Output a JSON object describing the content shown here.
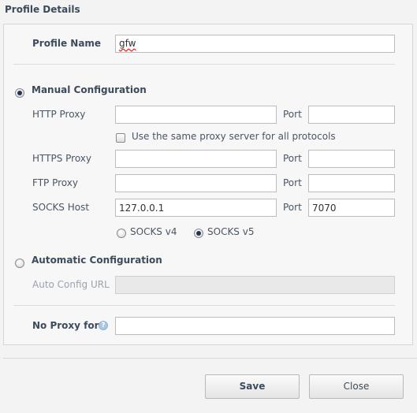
{
  "header": {
    "title": "Profile Details"
  },
  "profile": {
    "name_label": "Profile Name",
    "name_value": "gfw"
  },
  "manual": {
    "label": "Manual Configuration",
    "selected": true,
    "http_label": "HTTP Proxy",
    "http_value": "",
    "http_port_label": "Port",
    "http_port_value": "",
    "same_proxy_label": "Use the same proxy server for all protocols",
    "same_proxy_checked": false,
    "https_label": "HTTPS Proxy",
    "https_value": "",
    "https_port_label": "Port",
    "https_port_value": "",
    "ftp_label": "FTP Proxy",
    "ftp_value": "",
    "ftp_port_label": "Port",
    "ftp_port_value": "",
    "socks_label": "SOCKS Host",
    "socks_value": "127.0.0.1",
    "socks_port_label": "Port",
    "socks_port_value": "7070",
    "socks_v4_label": "SOCKS v4",
    "socks_v5_label": "SOCKS v5",
    "socks_version": "v5"
  },
  "auto": {
    "label": "Automatic Configuration",
    "selected": false,
    "url_label": "Auto Config URL",
    "url_value": ""
  },
  "noproxy": {
    "label": "No Proxy for",
    "help_glyph": "?",
    "value": ""
  },
  "buttons": {
    "save": "Save",
    "close": "Close"
  },
  "colors": {
    "selected_radio": "#1f3550",
    "help_icon": "#a9c7e5"
  }
}
